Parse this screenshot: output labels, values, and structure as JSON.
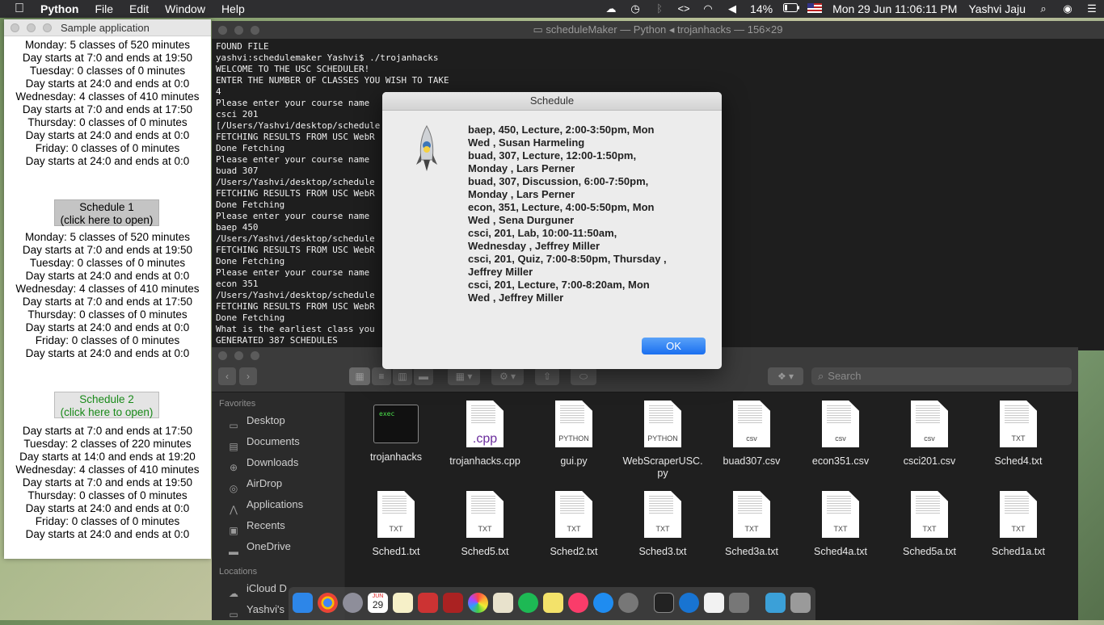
{
  "menubar": {
    "app": "Python",
    "items": [
      "File",
      "Edit",
      "Window",
      "Help"
    ],
    "battery": "14%",
    "datetime": "Mon 29 Jun  11:06:11 PM",
    "user": "Yashvi Jaju"
  },
  "sample_window": {
    "title": "Sample application",
    "block1": [
      "Monday: 5 classes of 520 minutes",
      "Day starts at 7:0 and ends at 19:50",
      "Tuesday: 0 classes of 0 minutes",
      "Day starts at 24:0 and ends at 0:0",
      "Wednesday: 4 classes of 410 minutes",
      "Day starts at 7:0 and ends at 17:50",
      "Thursday: 0 classes of 0 minutes",
      "Day starts at 24:0 and ends at 0:0",
      "Friday: 0 classes of 0 minutes",
      "Day starts at 24:0 and ends at 0:0"
    ],
    "btn1_line1": "Schedule 1",
    "btn1_line2": "(click here to open)",
    "block2": [
      "Monday: 5 classes of 520 minutes",
      "Day starts at 7:0 and ends at 19:50",
      "Tuesday: 0 classes of 0 minutes",
      "Day starts at 24:0 and ends at 0:0",
      "Wednesday: 4 classes of 410 minutes",
      "Day starts at 7:0 and ends at 17:50",
      "Thursday: 0 classes of 0 minutes",
      "Day starts at 24:0 and ends at 0:0",
      "Friday: 0 classes of 0 minutes",
      "Day starts at 24:0 and ends at 0:0"
    ],
    "btn2_line1": "Schedule 2",
    "btn2_line2": "(click here to open)",
    "block3": [
      "Day starts at 7:0 and ends at 17:50",
      "Tuesday: 2 classes of 220 minutes",
      "Day starts at 14:0 and ends at 19:20",
      "Wednesday: 4 classes of 410 minutes",
      "Day starts at 7:0 and ends at 19:50",
      "Thursday: 0 classes of 0 minutes",
      "Day starts at 24:0 and ends at 0:0",
      "Friday: 0 classes of 0 minutes",
      "Day starts at 24:0 and ends at 0:0"
    ]
  },
  "terminal": {
    "title": "scheduleMaker — Python ◂ trojanhacks — 156×29",
    "lines": [
      "FOUND FILE",
      "yashvi:schedulemaker Yashvi$ ./trojanhacks",
      "WELCOME TO THE USC SCHEDULER!",
      "ENTER THE NUMBER OF CLASSES YOU WISH TO TAKE",
      "4",
      "Please enter your course name",
      "csci 201",
      "[/Users/Yashvi/desktop/schedule",
      "FETCHING RESULTS FROM USC WebR",
      "Done Fetching",
      "Please enter your course name",
      "buad 307",
      "/Users/Yashvi/desktop/schedule",
      "FETCHING RESULTS FROM USC WebR",
      "Done Fetching",
      "Please enter your course name",
      "baep 450",
      "/Users/Yashvi/desktop/schedule",
      "FETCHING RESULTS FROM USC WebR",
      "Done Fetching",
      "Please enter your course name",
      "econ 351",
      "/Users/Yashvi/desktop/schedule",
      "FETCHING RESULTS FROM USC WebR",
      "Done Fetching",
      "What is the earliest class you",
      "GENERATED 387 SCHEDULES"
    ]
  },
  "dialog": {
    "title": "Schedule",
    "lines": [
      "baep, 450, Lecture, 2:00-3:50pm, Mon",
      "Wed , Susan Harmeling",
      "buad, 307, Lecture, 12:00-1:50pm,",
      "Monday , Lars Perner",
      "buad, 307, Discussion, 6:00-7:50pm,",
      "Monday , Lars Perner",
      "econ, 351, Lecture, 4:00-5:50pm, Mon",
      "Wed , Sena Durguner",
      "csci, 201, Lab, 10:00-11:50am,",
      "Wednesday , Jeffrey Miller",
      "csci, 201, Quiz, 7:00-8:50pm, Thursday ,",
      "Jeffrey Miller",
      "csci, 201, Lecture, 7:00-8:20am, Mon",
      "Wed , Jeffrey Miller"
    ],
    "ok": "OK"
  },
  "finder": {
    "search_placeholder": "Search",
    "favorites_header": "Favorites",
    "favorites": [
      "Desktop",
      "Documents",
      "Downloads",
      "AirDrop",
      "Applications",
      "Recents",
      "OneDrive"
    ],
    "locations_header": "Locations",
    "locations": [
      "iCloud D",
      "Yashvi's"
    ],
    "files_row1": [
      {
        "name": "trojanhacks",
        "kind": "exec",
        "badge": "exec"
      },
      {
        "name": "trojanhacks.cpp",
        "kind": "cpp",
        "badge": ".cpp"
      },
      {
        "name": "gui.py",
        "kind": "doc",
        "badge": "PYTHON"
      },
      {
        "name": "WebScraperUSC.\npy",
        "kind": "doc",
        "badge": "PYTHON"
      },
      {
        "name": "buad307.csv",
        "kind": "doc",
        "badge": "csv"
      },
      {
        "name": "econ351.csv",
        "kind": "doc",
        "badge": "csv"
      },
      {
        "name": "csci201.csv",
        "kind": "doc",
        "badge": "csv"
      },
      {
        "name": "Sched4.txt",
        "kind": "doc",
        "badge": "TXT"
      }
    ],
    "files_row2": [
      {
        "name": "Sched1.txt",
        "badge": "TXT"
      },
      {
        "name": "Sched5.txt",
        "badge": "TXT"
      },
      {
        "name": "Sched2.txt",
        "badge": "TXT"
      },
      {
        "name": "Sched3.txt",
        "badge": "TXT"
      },
      {
        "name": "Sched3a.txt",
        "badge": "TXT"
      },
      {
        "name": "Sched4a.txt",
        "badge": "TXT"
      },
      {
        "name": "Sched5a.txt",
        "badge": "TXT"
      },
      {
        "name": "Sched1a.txt",
        "badge": "TXT"
      }
    ]
  },
  "dock": {
    "calendar_day": "29",
    "calendar_month": "JUN"
  }
}
